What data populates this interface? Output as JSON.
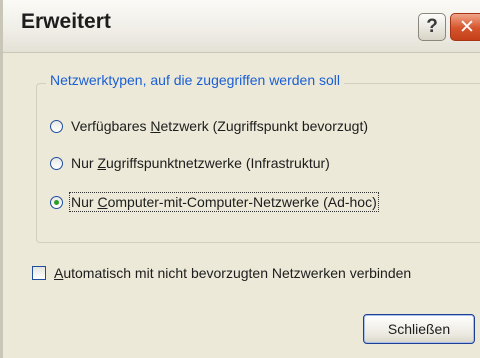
{
  "dialog": {
    "title": "Erweitert",
    "help_glyph": "?",
    "close_glyph": "✕"
  },
  "network_types": {
    "legend": "Netzwerktypen, auf die zugegriffen werden soll",
    "options": [
      {
        "before": "Verfügbares ",
        "accel": "N",
        "after": "etzwerk (Zugriffspunkt bevorzugt)",
        "checked": false
      },
      {
        "before": "Nur ",
        "accel": "Z",
        "after": "ugriffspunktnetzwerke (Infrastruktur)",
        "checked": false
      },
      {
        "before": "Nur ",
        "accel": "C",
        "after": "omputer-mit-Computer-Netzwerke (Ad-hoc)",
        "checked": true
      }
    ]
  },
  "auto_connect": {
    "accel": "A",
    "after": "utomatisch mit nicht bevorzugten Netzwerken verbinden",
    "checked": false
  },
  "buttons": {
    "close_label": "Schließen"
  },
  "colors": {
    "legend_text": "#1a5fd6",
    "close_button_red": "#d5542b",
    "radio_selected": "#2f9d2b"
  }
}
